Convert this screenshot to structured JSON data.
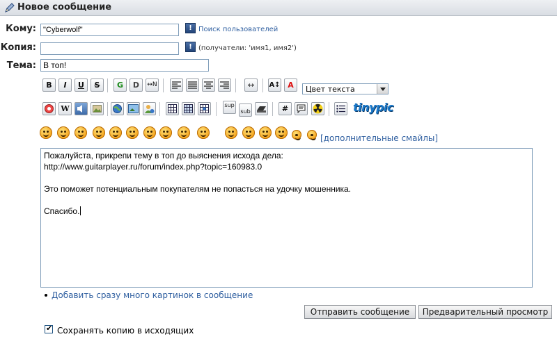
{
  "header": {
    "title": "Новое сообщение",
    "icon": "pen-icon"
  },
  "to": {
    "label": "Кому:",
    "value": "\"Cyberwolf\"",
    "search_link": "Поиск пользователей"
  },
  "cc": {
    "label": "Копия:",
    "value": "",
    "hint": "(получатели: 'имя1, имя2')"
  },
  "subject": {
    "label": "Тема:",
    "value": "В топ!"
  },
  "toolbar": {
    "row1": [
      "B",
      "I",
      "U",
      "S",
      "G",
      "D",
      "↔N",
      "align-left",
      "align-full",
      "align-center",
      "align-right",
      "↔",
      "A↕",
      "A"
    ],
    "color_select": "Цвет текста",
    "row2": [
      "youtube",
      "W",
      "video",
      "image",
      "globe",
      "photo",
      "user",
      "table",
      "table",
      "table",
      "sup",
      "sub",
      "hide",
      "#",
      "quote",
      "radiation",
      "list"
    ],
    "tinypic": "tinypic"
  },
  "smilies": {
    "more_link": "[дополнительные смайлы]",
    "count": 16
  },
  "message": {
    "text": "Пожалуйста, прикрепи тему в топ до выяснения исхода дела:\nhttp://www.guitarplayer.ru/forum/index.php?topic=160983.0\n\nЭто поможет потенциальным покупателям не попасться на удочку мошенника.\n\nСпасибо."
  },
  "add_images_link": "Добавить сразу много картинок в сообщение",
  "buttons": {
    "send": "Отправить сообщение",
    "preview": "Предварительный просмотр"
  },
  "save_copy": {
    "label": "Сохранять копию в исходящих",
    "checked": true
  }
}
